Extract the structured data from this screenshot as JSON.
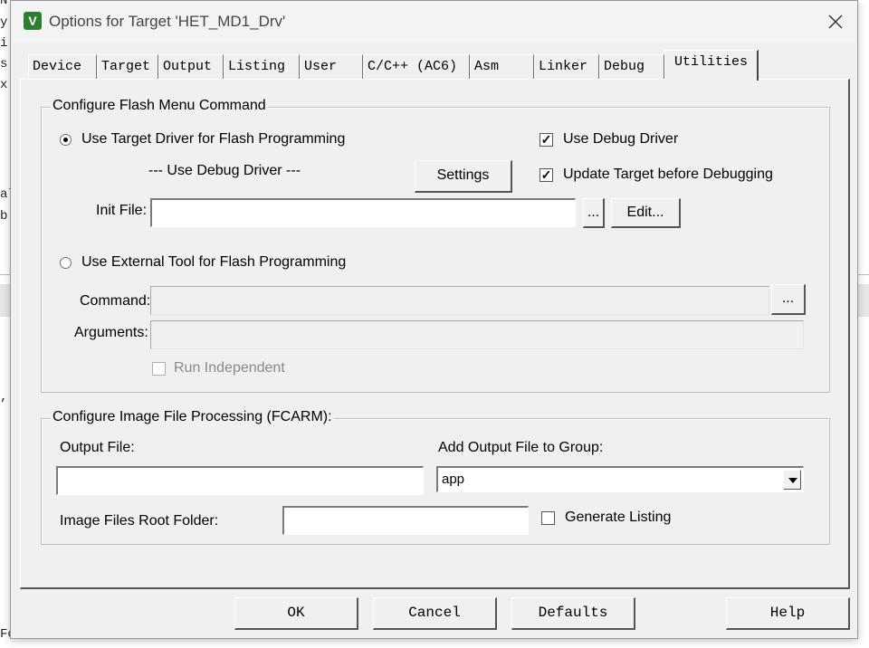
{
  "background": {
    "code_fragments": [
      "N",
      "y",
      "i",
      "s",
      "x",
      "al",
      "b",
      ",",
      "Fo"
    ]
  },
  "window": {
    "title": "Options for Target 'HET_MD1_Drv'",
    "icon": "uvision-app-icon",
    "close_icon": "close-icon"
  },
  "tabs": [
    {
      "label": "Device",
      "active": false
    },
    {
      "label": "Target",
      "active": false
    },
    {
      "label": "Output",
      "active": false
    },
    {
      "label": "Listing",
      "active": false
    },
    {
      "label": "User",
      "active": false
    },
    {
      "label": "C/C++ (AC6)",
      "active": false
    },
    {
      "label": "Asm",
      "active": false
    },
    {
      "label": "Linker",
      "active": false
    },
    {
      "label": "Debug",
      "active": false
    },
    {
      "label": "Utilities",
      "active": true
    }
  ],
  "flash": {
    "group_title": "Configure Flash Menu Command",
    "use_target_driver_label": "Use Target Driver for Flash Programming",
    "use_target_driver_selected": true,
    "driver_value": "--- Use Debug Driver ---",
    "settings_button": "Settings",
    "use_debug_driver_label": "Use Debug Driver",
    "use_debug_driver_checked": true,
    "update_target_label": "Update Target before Debugging",
    "update_target_checked": true,
    "init_file_label": "Init File:",
    "init_file_value": "",
    "browse_button": "...",
    "edit_button": "Edit...",
    "use_external_tool_label": "Use External Tool for Flash Programming",
    "use_external_tool_selected": false,
    "command_label": "Command:",
    "command_value": "",
    "command_browse_button": "...",
    "arguments_label": "Arguments:",
    "arguments_value": "",
    "run_independent_label": "Run Independent",
    "run_independent_checked": false
  },
  "image": {
    "group_title": "Configure Image File Processing (FCARM):",
    "output_file_label": "Output File:",
    "output_file_value": "",
    "add_output_label": "Add Output File  to Group:",
    "group_selected": "app",
    "root_folder_label": "Image Files Root Folder:",
    "root_folder_value": "",
    "generate_listing_label": "Generate Listing",
    "generate_listing_checked": false
  },
  "buttons": {
    "ok": "OK",
    "cancel": "Cancel",
    "defaults": "Defaults",
    "help": "Help"
  }
}
